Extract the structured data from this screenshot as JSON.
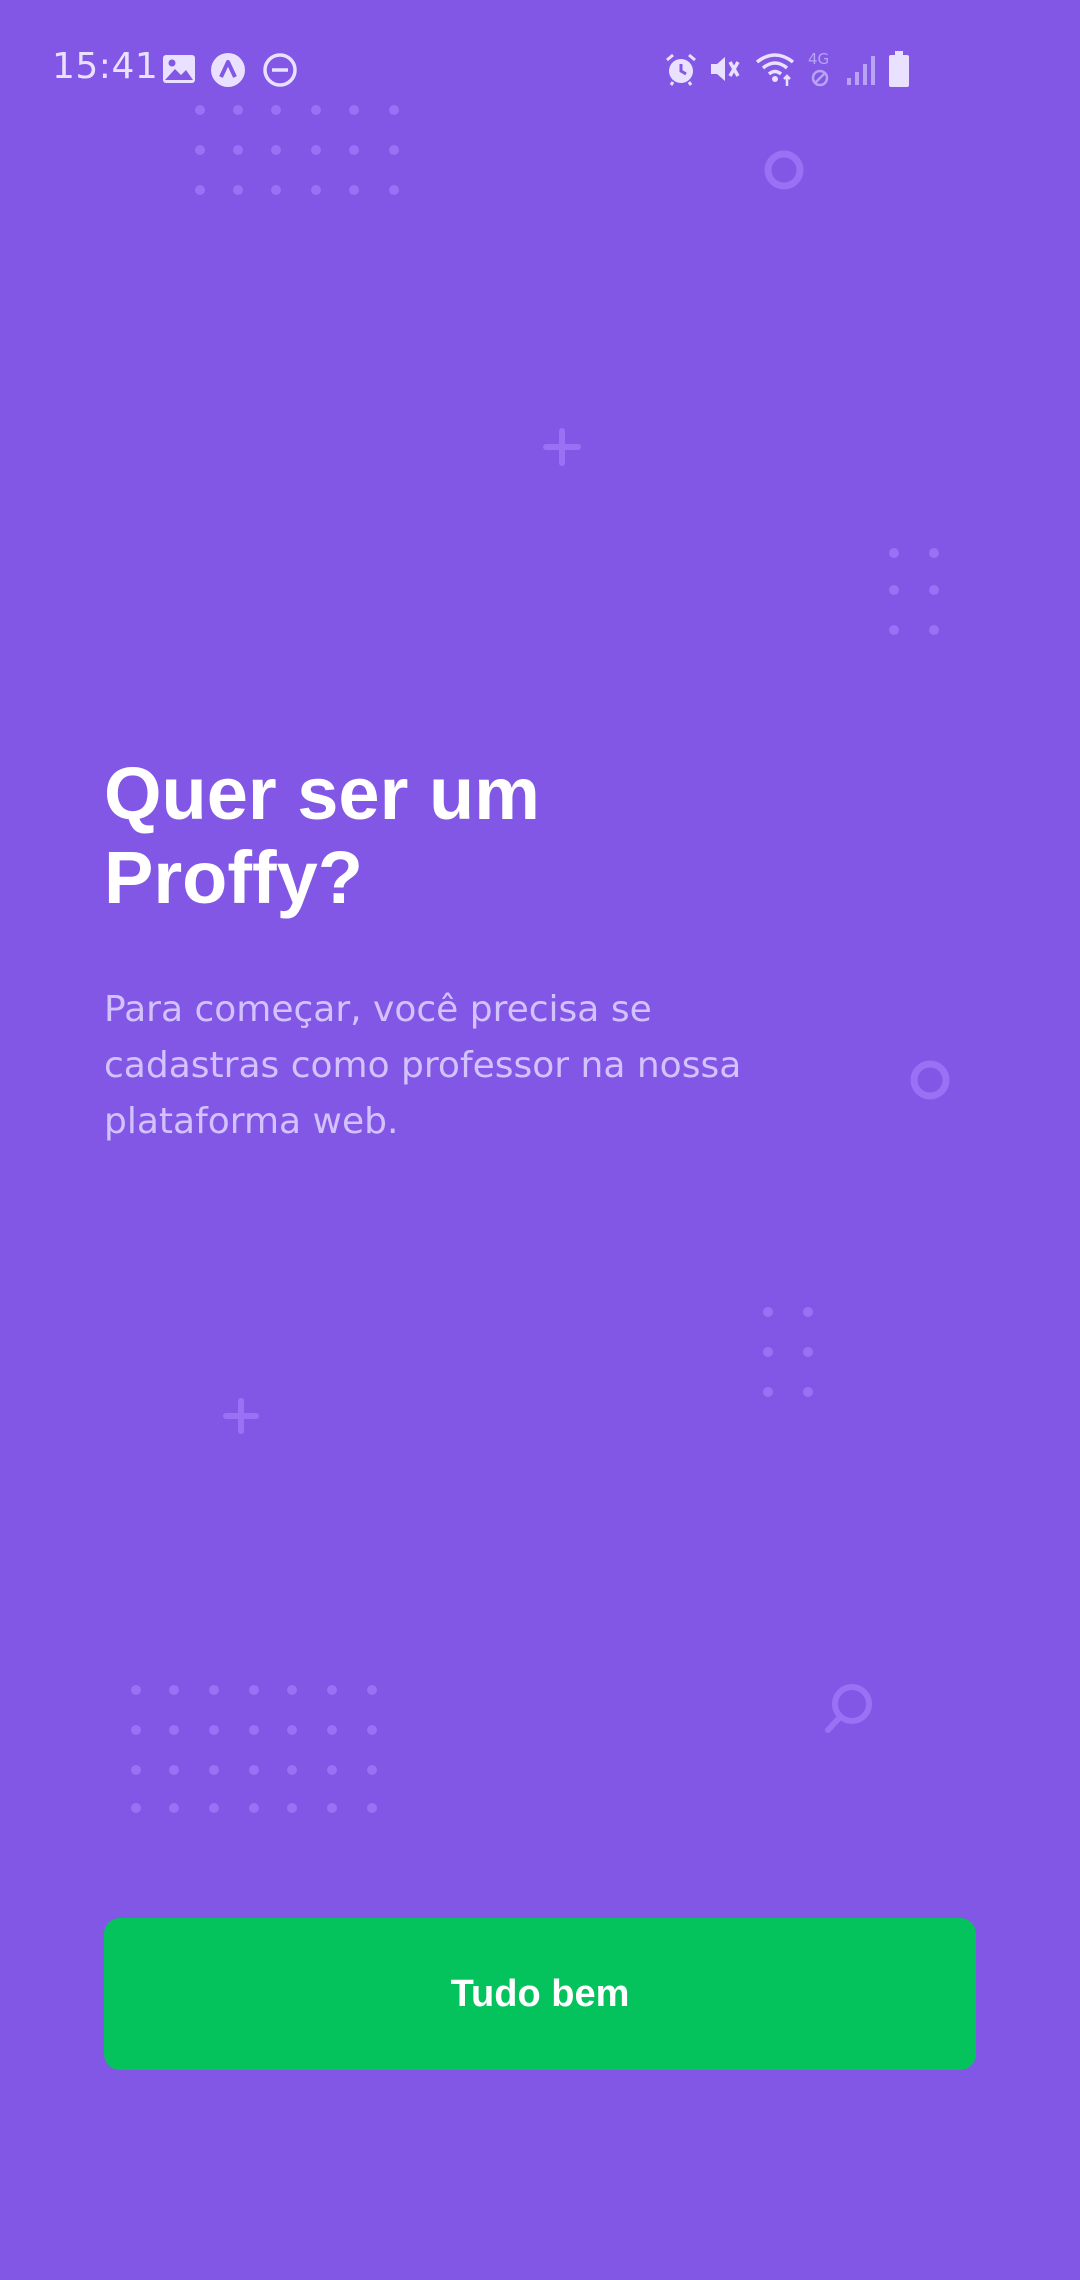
{
  "status_bar": {
    "time": "15:41",
    "left_icons": [
      "gallery-icon",
      "navigation-app-icon",
      "do-not-disturb-icon"
    ],
    "right_icons": [
      "alarm-icon",
      "vibrate-mute-icon",
      "wifi-icon",
      "4g-disabled-icon",
      "signal-icon",
      "battery-icon"
    ],
    "network_label": "4G"
  },
  "onboarding": {
    "title": "Quer ser um\nProffy?",
    "description": "Para começar, você precisa se cadastras como professor na nossa plataforma web.",
    "button_label": "Tudo bem"
  },
  "colors": {
    "background": "#8257E5",
    "title_text": "#FFFFFF",
    "description_text": "#D4C2FF",
    "button_background": "#04C35C",
    "button_text": "#FFFFFF",
    "decoration": "#9871F5"
  },
  "decorations": [
    "dot-grid",
    "ring",
    "plus",
    "dot-grid",
    "ring",
    "dot-grid",
    "plus",
    "dot-grid",
    "magnifier"
  ]
}
